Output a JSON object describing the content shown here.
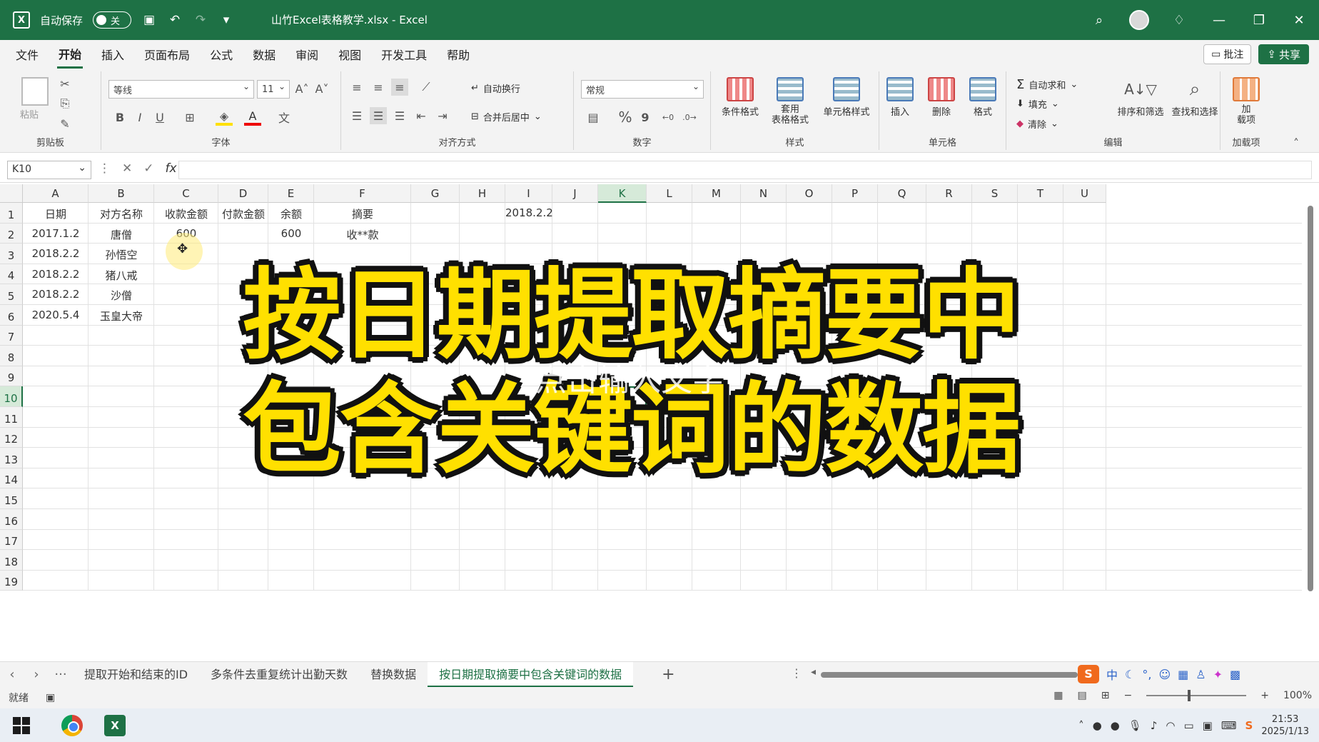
{
  "window": {
    "autosave_label": "自动保存",
    "autosave_state": "关",
    "doc_title": "山竹Excel表格教学.xlsx - Excel"
  },
  "menu": {
    "tabs": [
      "文件",
      "开始",
      "插入",
      "页面布局",
      "公式",
      "数据",
      "审阅",
      "视图",
      "开发工具",
      "帮助"
    ],
    "active": "开始",
    "comment_label": "批注",
    "share_label": "共享"
  },
  "ribbon": {
    "clipboard": {
      "paste": "粘贴",
      "label": "剪贴板"
    },
    "font": {
      "family": "等线",
      "size": "11",
      "bold": "B",
      "italic": "I",
      "underline": "U",
      "label": "字体"
    },
    "alignment": {
      "wrap": "自动换行",
      "merge": "合并后居中",
      "label": "对齐方式"
    },
    "number": {
      "format": "常规",
      "percent": "%",
      "comma": "9",
      "label": "数字"
    },
    "styles": {
      "conditional": "条件格式",
      "table": "套用\n表格格式",
      "cell_styles": "单元格样式",
      "label": "样式"
    },
    "cells": {
      "insert": "插入",
      "delete": "删除",
      "format": "格式",
      "label": "单元格"
    },
    "editing": {
      "autosum": "自动求和",
      "fill": "填充",
      "clear": "清除",
      "sort": "排序和筛选",
      "find": "查找和选择",
      "label": "编辑"
    },
    "addins": {
      "addins": "加\n载项",
      "label": "加载项"
    }
  },
  "formula_bar": {
    "name_box": "K10",
    "fx": "fx",
    "content": ""
  },
  "sheet": {
    "columns": [
      "A",
      "B",
      "C",
      "D",
      "E",
      "F",
      "G",
      "H",
      "I",
      "J",
      "K",
      "L",
      "M",
      "N",
      "O",
      "P",
      "Q",
      "R",
      "S",
      "T",
      "U"
    ],
    "selected_column": "K",
    "rows": [
      "1",
      "2",
      "3",
      "4",
      "5",
      "6",
      "7",
      "8",
      "9",
      "10",
      "11",
      "12",
      "13",
      "14",
      "15",
      "16",
      "17",
      "18",
      "19"
    ],
    "selected_row": "10",
    "headers": [
      "日期",
      "对方名称",
      "收款金额",
      "付款金额",
      "余额",
      "摘要"
    ],
    "data": [
      [
        "2017.1.2",
        "唐僧",
        "600",
        "",
        "600",
        "收**款"
      ],
      [
        "2018.2.2",
        "孙悟空",
        "",
        "",
        "",
        ""
      ],
      [
        "2018.2.2",
        "猪八戒",
        "",
        "",
        "",
        ""
      ],
      [
        "2018.2.2",
        "沙僧",
        "",
        "",
        "",
        ""
      ],
      [
        "2020.5.4",
        "玉皇大帝",
        "",
        "",
        "",
        ""
      ]
    ],
    "i1_value": "2018.2.2"
  },
  "overlay": {
    "line1": "按日期提取摘要中",
    "line2": "包含关键词的数据",
    "hint": "点击输入文字"
  },
  "sheet_tabs": {
    "tabs": [
      "提取开始和结束的ID",
      "多条件去重复统计出勤天数",
      "替换数据",
      "按日期提取摘要中包含关键词的数据"
    ],
    "active_index": 3,
    "more": "···",
    "add": "+"
  },
  "status": {
    "ready": "就绪",
    "zoom": "100%"
  },
  "ime": {
    "mode": "中"
  },
  "taskbar": {
    "time": "21:53",
    "date": "2025/1/13"
  },
  "colors": {
    "excel_green": "#1e7145",
    "headline_yellow": "#ffe000"
  }
}
